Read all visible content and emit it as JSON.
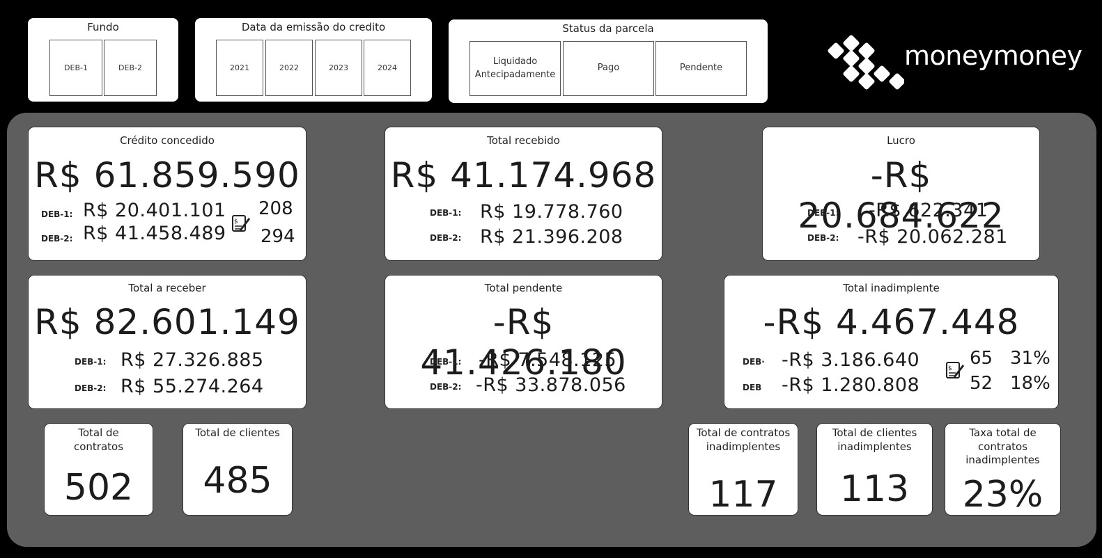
{
  "slicers": {
    "fundo": {
      "title": "Fundo",
      "options": [
        "DEB-1",
        "DEB-2"
      ]
    },
    "data_emissao": {
      "title": "Data da emissão do credito",
      "options": [
        "2021",
        "2022",
        "2023",
        "2024"
      ]
    },
    "status": {
      "title": "Status da parcela",
      "options": [
        "Liquidado Antecipadamente",
        "Pago",
        "Pendente"
      ]
    }
  },
  "logo": {
    "text": "moneymoney",
    "icon": "diamond-grid-logo-icon"
  },
  "cards": {
    "credito": {
      "title": "Crédito concedido",
      "total": "R$ 61.859.590",
      "deb1_label": "DEB-1:",
      "deb1_value": "R$ 20.401.101",
      "deb2_label": "DEB-2:",
      "deb2_value": "R$ 41.458.489",
      "deb1_count": "208",
      "deb2_count": "294",
      "icon": "contract-icon"
    },
    "recebido": {
      "title": "Total recebido",
      "total": "R$ 41.174.968",
      "deb1_label": "DEB-1:",
      "deb1_value": "R$ 19.778.760",
      "deb2_label": "DEB-2:",
      "deb2_value": "R$ 21.396.208"
    },
    "lucro": {
      "title": "Lucro",
      "total": "-R$ 20.684.622",
      "deb1_label": "DEB-1:",
      "deb1_value": "-R$ 622.341",
      "deb2_label": "DEB-2:",
      "deb2_value": "-R$ 20.062.281"
    },
    "a_receber": {
      "title": "Total a receber",
      "total": "R$ 82.601.149",
      "deb1_label": "DEB-1:",
      "deb1_value": "R$ 27.326.885",
      "deb2_label": "DEB-2:",
      "deb2_value": "R$ 55.274.264"
    },
    "pendente": {
      "title": "Total pendente",
      "total": "-R$ 41.426.180",
      "deb1_label": "DEB-1:",
      "deb1_value": "-R$ 7.548.125",
      "deb2_label": "DEB-2:",
      "deb2_value": "-R$ 33.878.056"
    },
    "inadimplente": {
      "title": "Total inadimplente",
      "total": "-R$ 4.467.448",
      "deb1_label": "DEB·",
      "deb1_value": "-R$ 3.186.640",
      "deb2_label": "DEB",
      "deb2_value": "-R$ 1.280.808",
      "deb1_count": "65",
      "deb2_count": "52",
      "deb1_pct": "31%",
      "deb2_pct": "18%",
      "icon": "contract-icon"
    }
  },
  "kpis": {
    "contratos": {
      "title": "Total de contratos",
      "value": "502"
    },
    "clientes": {
      "title": "Total de clientes",
      "value": "485"
    },
    "contratos_inad": {
      "title": "Total de contratos inadimplentes",
      "value": "117"
    },
    "clientes_inad": {
      "title": "Total de clientes inadimplentes",
      "value": "113"
    },
    "taxa_inad": {
      "title": "Taxa total de contratos inadimplentes",
      "value": "23%"
    }
  }
}
